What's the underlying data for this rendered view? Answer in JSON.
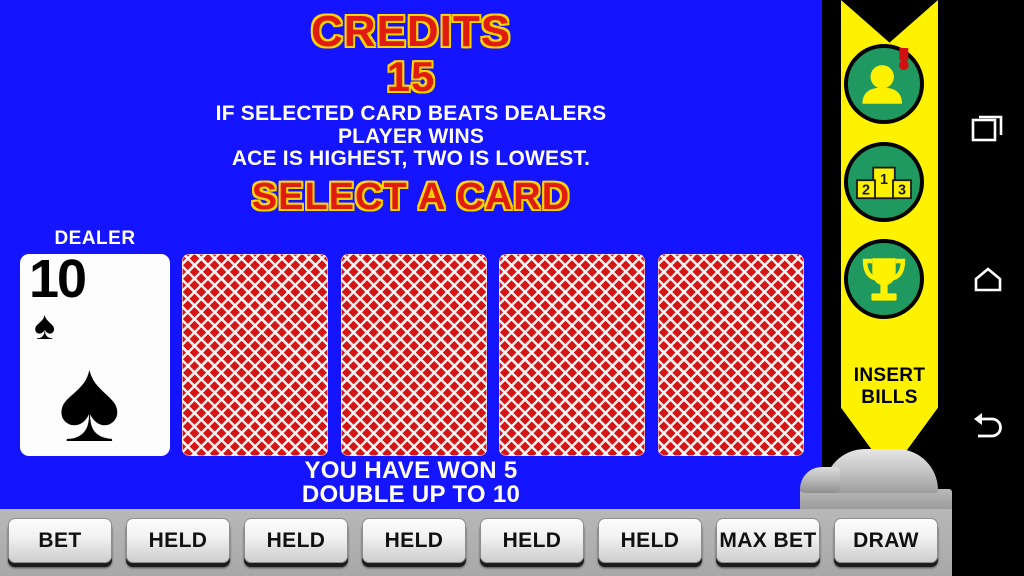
{
  "game": {
    "credits_label": "CREDITS",
    "credits_value": "15",
    "instructions": [
      "IF SELECTED CARD BEATS DEALERS",
      "PLAYER WINS",
      "ACE IS HIGHEST, TWO IS LOWEST."
    ],
    "prompt": "SELECT A CARD",
    "dealer": {
      "label": "DEALER",
      "rank": "10",
      "suit_glyph": "♠",
      "suit_name": "spades"
    },
    "player_cards": [
      {
        "state": "face-down",
        "back_name": "card-back"
      },
      {
        "state": "face-down",
        "back_name": "card-back"
      },
      {
        "state": "face-down",
        "back_name": "card-back"
      },
      {
        "state": "face-down",
        "back_name": "card-back"
      }
    ],
    "win_lines": [
      "YOU HAVE WON 5",
      "DOUBLE UP TO 10"
    ],
    "colors": {
      "felt_blue": "#1414ff",
      "headline_red": "#e01b10",
      "headline_outline": "#ffd400",
      "card_back_red": "#d41515",
      "strip_yellow": "#fff200",
      "badge_green": "#1f9960"
    }
  },
  "bill_strip": {
    "insert_label_line1": "INSERT",
    "insert_label_line2": "BILLS",
    "badges": [
      {
        "name": "player-profile-alert-icon",
        "label": "player"
      },
      {
        "name": "leaderboard-podium-icon",
        "label": "ranks",
        "places": [
          "1",
          "2",
          "3"
        ]
      },
      {
        "name": "trophy-icon",
        "label": "achievements"
      }
    ]
  },
  "buttons": [
    {
      "label": "BET",
      "name": "bet-button"
    },
    {
      "label": "HELD",
      "name": "held-button-1"
    },
    {
      "label": "HELD",
      "name": "held-button-2"
    },
    {
      "label": "HELD",
      "name": "held-button-3"
    },
    {
      "label": "HELD",
      "name": "held-button-4"
    },
    {
      "label": "HELD",
      "name": "held-button-5"
    },
    {
      "label": "MAX BET",
      "name": "max-bet-button"
    },
    {
      "label": "DRAW",
      "name": "draw-button"
    }
  ],
  "nav_bar": {
    "items": [
      {
        "name": "recents-icon",
        "label": "Recents"
      },
      {
        "name": "home-icon",
        "label": "Home"
      },
      {
        "name": "back-icon",
        "label": "Back"
      }
    ]
  }
}
